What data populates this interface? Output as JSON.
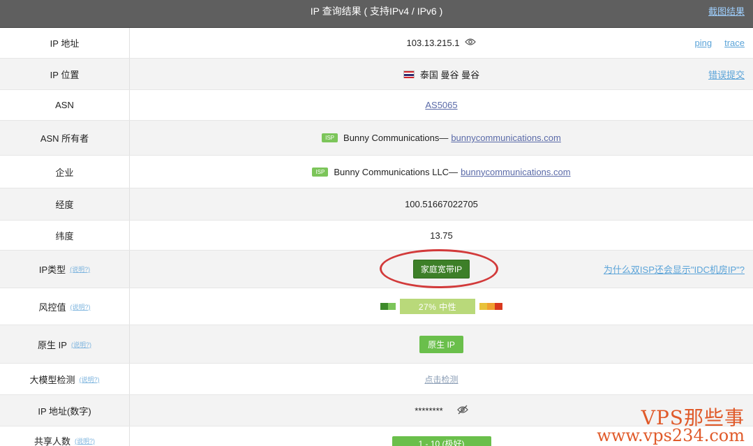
{
  "header": {
    "title": "IP 查询结果 ( 支持IPv4 / IPv6 )",
    "screenshot_link": "截图结果"
  },
  "rows": {
    "ip": {
      "label": "IP 地址",
      "value": "103.13.215.1",
      "ping": "ping",
      "trace": "trace"
    },
    "location": {
      "label": "IP 位置",
      "value": "泰国 曼谷 曼谷",
      "report": "错误提交"
    },
    "asn": {
      "label": "ASN",
      "value": "AS5065"
    },
    "asn_owner": {
      "label": "ASN 所有者",
      "badge": "ISP",
      "name": "Bunny Communications—",
      "domain": "bunnycommunications.com"
    },
    "company": {
      "label": "企业",
      "badge": "ISP",
      "name": "Bunny Communications LLC—",
      "domain": "bunnycommunications.com"
    },
    "longitude": {
      "label": "经度",
      "value": "100.51667022705"
    },
    "latitude": {
      "label": "纬度",
      "value": "13.75"
    },
    "ip_type": {
      "label": "IP类型",
      "help": "(说明?)",
      "value": "家庭宽带IP",
      "why_link": "为什么双ISP还会显示\"IDC机房IP\"?"
    },
    "risk": {
      "label": "风控值",
      "help": "(说明?)",
      "value": "27%  中性",
      "percent": 27,
      "colors": [
        "#3d8a2a",
        "#7cc55a",
        "#e8c23a",
        "#f0a030",
        "#d9381e"
      ]
    },
    "native_ip": {
      "label": "原生 IP",
      "help": "(说明?)",
      "value": "原生 IP"
    },
    "llm_detect": {
      "label": "大模型检测",
      "help": "(说明?)",
      "value": "点击检测"
    },
    "ip_numeric": {
      "label": "IP 地址(数字)",
      "value": "********"
    },
    "shared_users": {
      "label": "共享人数",
      "help": "(说明?)",
      "value": "1 - 10 (极好)"
    }
  },
  "watermark": {
    "line1": "VPS那些事",
    "line2": "www.vps234.com"
  },
  "icons": {
    "eye": "eye-icon",
    "eye_slash": "eye-slash-icon",
    "flag": "thailand-flag-icon"
  }
}
